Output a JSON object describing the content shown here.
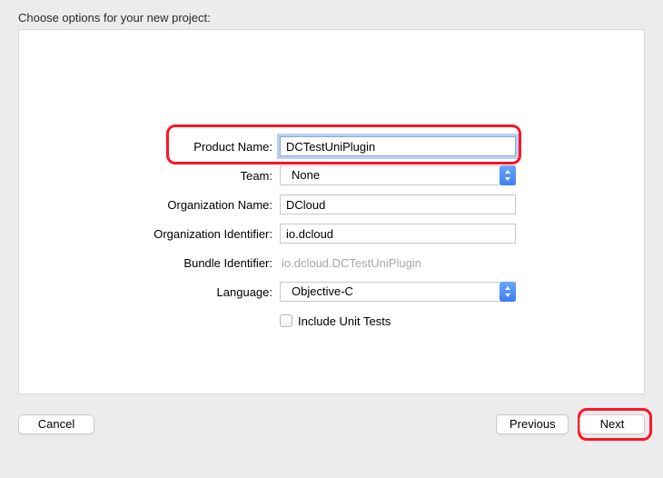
{
  "header": {
    "title": "Choose options for your new project:"
  },
  "labels": {
    "product_name": "Product Name:",
    "team": "Team:",
    "org_name": "Organization Name:",
    "org_identifier": "Organization Identifier:",
    "bundle_identifier": "Bundle Identifier:",
    "language": "Language:",
    "include_unit_tests": "Include Unit Tests"
  },
  "values": {
    "product_name": "DCTestUniPlugin",
    "team": "None",
    "org_name": "DCloud",
    "org_identifier": "io.dcloud",
    "bundle_identifier": "io.dcloud.DCTestUniPlugin",
    "language": "Objective-C",
    "include_unit_tests_checked": false
  },
  "buttons": {
    "cancel": "Cancel",
    "previous": "Previous",
    "next": "Next"
  }
}
